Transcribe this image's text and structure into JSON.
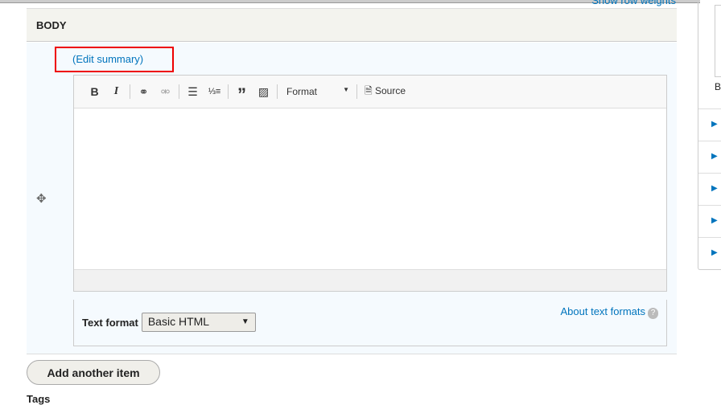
{
  "top": {
    "row_weights": "Show row weights"
  },
  "field": {
    "title": "BODY",
    "edit_summary": "(Edit summary)"
  },
  "toolbar": {
    "bold": "B",
    "italic": "I",
    "format": "Format",
    "source": "Source"
  },
  "text_format": {
    "label": "Text format",
    "selected": "Basic HTML",
    "about": "About text formats",
    "help": "?"
  },
  "add_another": "Add another item",
  "tags_label": "Tags",
  "sidebar": {
    "label": "B",
    "rows": [
      "▶",
      "▶",
      "▶",
      "▶",
      "▶"
    ]
  }
}
